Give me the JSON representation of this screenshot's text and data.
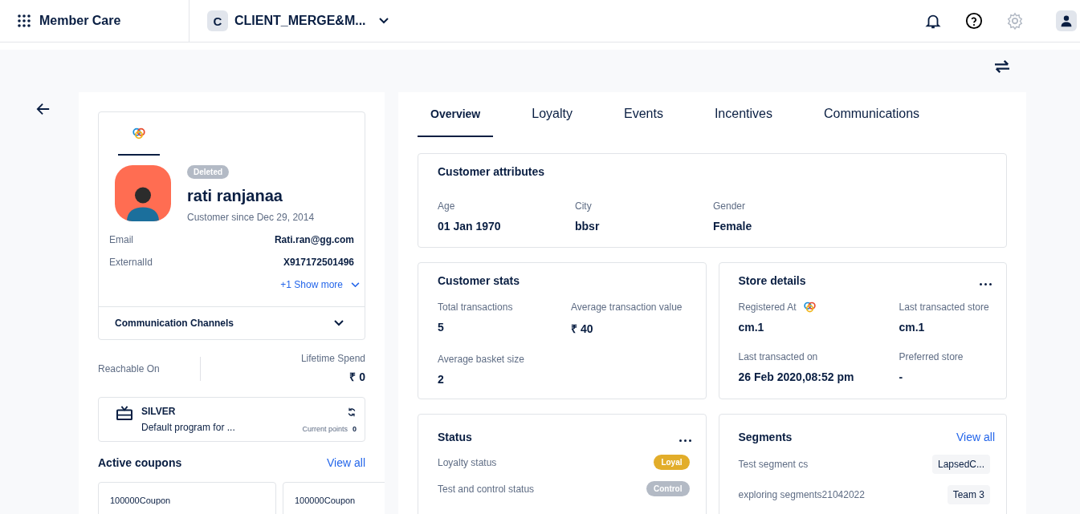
{
  "header": {
    "app_name": "Member Care",
    "org_initial": "C",
    "org_name": "CLIENT_MERGE&M..."
  },
  "profile": {
    "logo_tab_selected": true,
    "status_badge": "Deleted",
    "name": "rati ranjanaa",
    "since": "Customer since Dec 29, 2014",
    "fields": [
      {
        "label": "Email",
        "value": "Rati.ran@gg.com"
      },
      {
        "label": "ExternalId",
        "value": "X917172501496"
      }
    ],
    "show_more": "+1 Show more",
    "channels": {
      "label": "Communication Channels",
      "expanded": false
    },
    "reachable_label": "Reachable On",
    "lifetime_label": "Lifetime Spend",
    "lifetime_value": "₹ 0"
  },
  "loyalty": {
    "tier": "SILVER",
    "program": "Default program for ...",
    "points_label": "Current points",
    "points": "0"
  },
  "coupons": {
    "title": "Active coupons",
    "view_all": "View all",
    "items": [
      "100000Coupon",
      "100000Coupon"
    ]
  },
  "tabs": [
    {
      "label": "Overview",
      "selected": true
    },
    {
      "label": "Loyalty",
      "selected": false
    },
    {
      "label": "Events",
      "selected": false
    },
    {
      "label": "Incentives",
      "selected": false
    },
    {
      "label": "Communications",
      "selected": false
    }
  ],
  "attributes": {
    "title": "Customer attributes",
    "fields": [
      {
        "label": "Age",
        "value": "01 Jan 1970"
      },
      {
        "label": "City",
        "value": "bbsr"
      },
      {
        "label": "Gender",
        "value": "Female"
      }
    ]
  },
  "stats": {
    "title": "Customer stats",
    "fields": [
      {
        "label": "Total transactions",
        "value": "5"
      },
      {
        "label": "Average transaction value",
        "value": "₹ 40"
      },
      {
        "label": "Average basket size",
        "value": "2"
      }
    ]
  },
  "store": {
    "title": "Store details",
    "fields": [
      {
        "label": "Registered At",
        "value": "cm.1",
        "kind": "logo"
      },
      {
        "label": "Last transacted store",
        "value": "cm.1",
        "kind": "plain"
      },
      {
        "label": "Last transacted on",
        "value": "26 Feb 2020,08:52 pm",
        "kind": "plain"
      },
      {
        "label": "Preferred store",
        "value": "-",
        "kind": "plain"
      }
    ]
  },
  "status": {
    "title": "Status",
    "rows": [
      {
        "label": "Loyalty status",
        "badge": "Loyal",
        "color": "#e2ad2a"
      },
      {
        "label": "Test and control status",
        "badge": "Control",
        "color": "#b3bac5"
      }
    ]
  },
  "segments": {
    "title": "Segments",
    "view_all": "View all",
    "rows": [
      {
        "name": "Test segment cs",
        "tag": "LapsedC..."
      },
      {
        "name": "exploring segments21042022",
        "tag": "Team 3"
      }
    ]
  }
}
